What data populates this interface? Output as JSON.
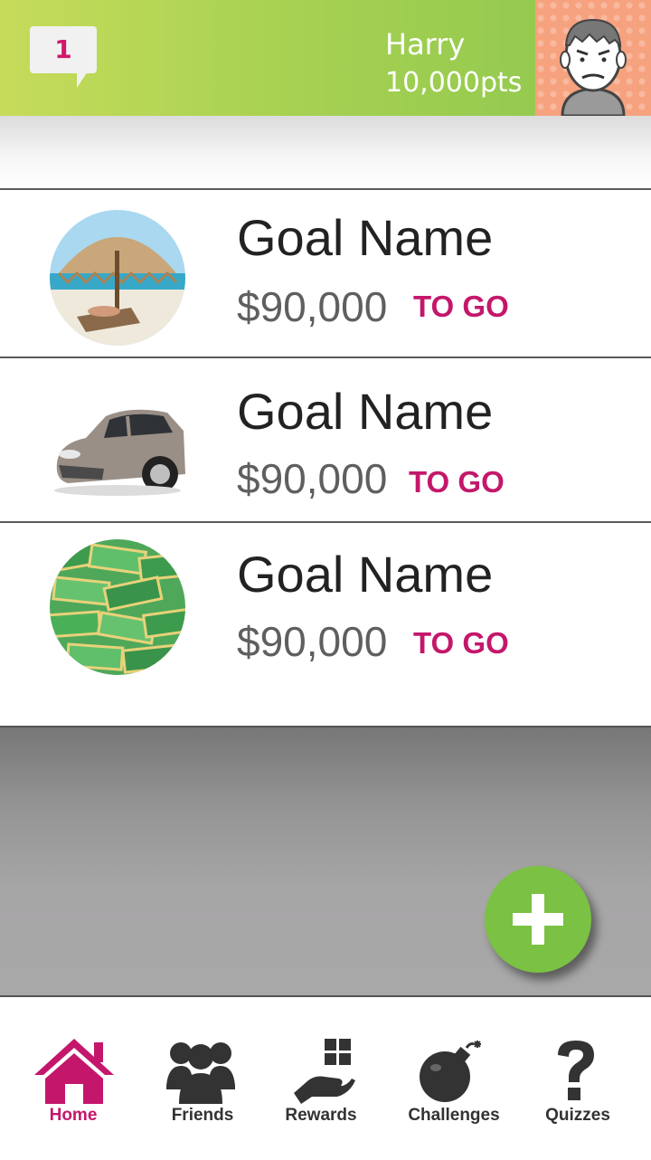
{
  "header": {
    "message_count": "1",
    "user_name": "Harry",
    "user_points": "10,000pts"
  },
  "goals": [
    {
      "name": "Goal Name",
      "amount": "$90,000",
      "suffix": "TO GO",
      "image": "beach-umbrella-photo"
    },
    {
      "name": "Goal Name",
      "amount": "$90,000",
      "suffix": "TO GO",
      "image": "car-photo"
    },
    {
      "name": "Goal Name",
      "amount": "$90,000",
      "suffix": "TO GO",
      "image": "cash-stacks-photo"
    }
  ],
  "fab": {
    "icon": "plus-icon"
  },
  "nav": [
    {
      "label": "Home",
      "icon": "home-icon",
      "active": true
    },
    {
      "label": "Friends",
      "icon": "friends-icon"
    },
    {
      "label": "Rewards",
      "icon": "rewards-icon"
    },
    {
      "label": "Challenges",
      "icon": "bomb-icon"
    },
    {
      "label": "Quizzes",
      "icon": "question-icon"
    }
  ],
  "colors": {
    "accent": "#c4176b",
    "header_green": "#8cc74e",
    "fab_green": "#7bc143"
  }
}
